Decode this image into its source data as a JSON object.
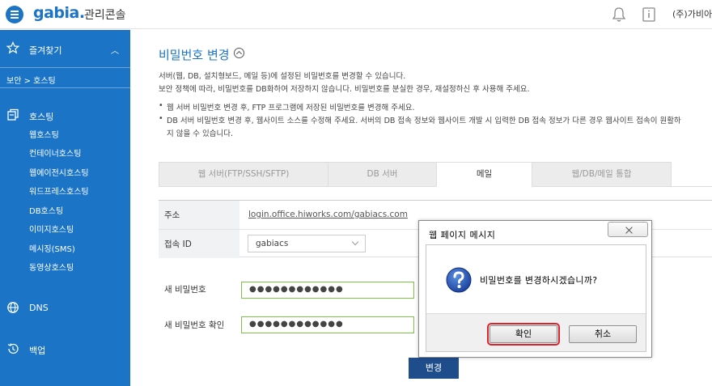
{
  "header": {
    "logo": "gabia.",
    "console_title": "관리콘솔",
    "company": "(주)가비아"
  },
  "sidebar": {
    "favorites_label": "즐겨찾기",
    "breadcrumb": "보안 > 호스팅",
    "hosting_label": "호스팅",
    "hosting_items": [
      "웹호스팅",
      "컨테이너호스팅",
      "웹에이전시호스팅",
      "워드프레스호스팅",
      "DB호스팅",
      "이미지호스팅",
      "메시징(SMS)",
      "동영상호스팅"
    ],
    "dns_label": "DNS",
    "backup_label": "백업"
  },
  "main": {
    "title": "비밀번호 변경",
    "desc_lines": [
      "서버(웹, DB, 설치형보드, 메일 등)에 설정된 비밀번호를 변경할 수 있습니다.",
      "보안 정책에 따라, 비밀번호를 DB화하여 저장하지 않습니다. 비밀번호를 분실한 경우, 재설정하신 후 사용해 주세요."
    ],
    "bullets": [
      "웹 서버 비밀번호 변경 후, FTP 프로그램에 저장된 비밀번호를 변경해 주세요.",
      "DB 서버 비밀번호 변경 후, 웹사이트 소스를 수정해 주세요. 서버의 DB 접속 정보와 웹사이트 개발 시 입력한 DB 접속 정보가 다른 경우 웹사이트 접속이 원활하",
      "지 않을 수 있습니다."
    ],
    "tabs": [
      "웹 서버(FTP/SSH/SFTP)",
      "DB 서버",
      "메일",
      "웹/DB/메일 통합"
    ],
    "active_tab": "메일",
    "address_label": "주소",
    "address_value": "login.office.hiworks.com/gabiacs.com",
    "access_id_label": "접속 ID",
    "access_id_value": "gabiacs",
    "new_pw_label": "새 비밀번호",
    "new_pw_value": "●●●●●●●●●●●●",
    "confirm_pw_label": "새 비밀번호 확인",
    "confirm_pw_value": "●●●●●●●●●●●●",
    "change_button": "변경"
  },
  "dialog": {
    "title": "웹 페이지 메시지",
    "message": "비밀번호를 변경하시겠습니까?",
    "ok_label": "확인",
    "cancel_label": "취소"
  },
  "colors": {
    "brand_blue": "#1b74c5",
    "button_navy": "#1f4d8c",
    "input_border_green": "#7cc24b",
    "highlight_red": "#e0202b"
  }
}
